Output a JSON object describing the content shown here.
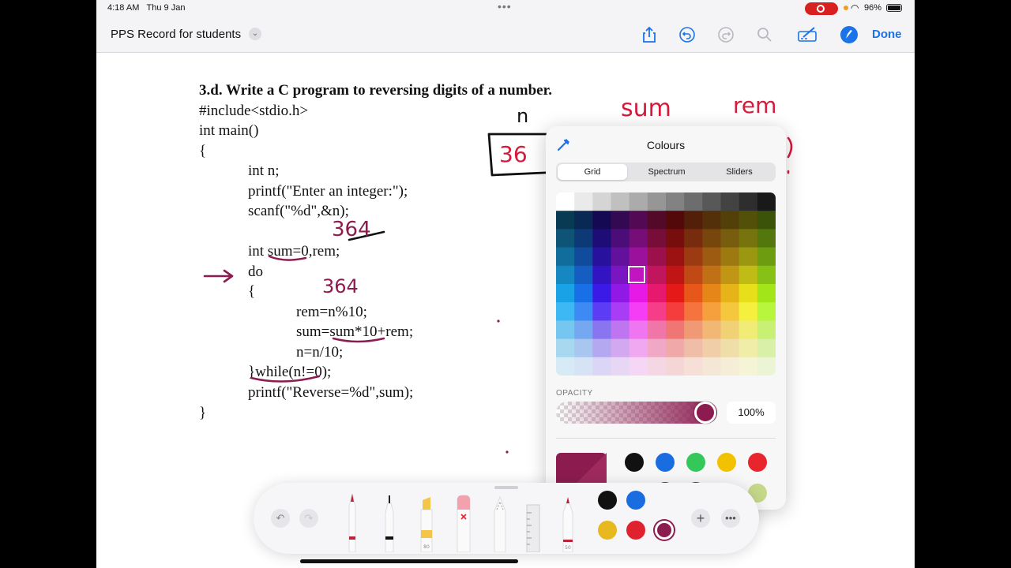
{
  "status_bar": {
    "time": "4:18 AM",
    "date": "Thu 9 Jan",
    "battery": "96%",
    "more_dots": "•••"
  },
  "nav": {
    "document_title": "PPS Record for students",
    "done_label": "Done",
    "icons": [
      "share-icon",
      "undo-icon",
      "redo-icon",
      "search-icon",
      "markup-icon",
      "pencil-circle-icon"
    ]
  },
  "document": {
    "lines": [
      "3.d. Write a C program to reversing digits of a number.",
      "#include<stdio.h>",
      "int main()",
      "{",
      "int n;",
      "printf(\"Enter an integer:\");",
      "scanf(\"%d\",&n);",
      "int sum=0,rem;",
      "do",
      "{",
      "rem=n%10;",
      "sum=sum*10+rem;",
      "n=n/10;",
      "}while(n!=0);",
      "printf(\"Reverse=%d\",sum);",
      "}"
    ]
  },
  "handwriting": {
    "n_label": "n",
    "sum_label": "sum",
    "rem_label": "rem",
    "n_box_value": "36",
    "scribble_top": "364",
    "scribble_mid": "364",
    "arrow": "→"
  },
  "colour_picker": {
    "title": "Colours",
    "tabs": [
      "Grid",
      "Spectrum",
      "Sliders"
    ],
    "active_tab": "Grid",
    "opacity_label": "OPACITY",
    "opacity_value": "100%",
    "selected_colour": "#8c1c50",
    "swatches_row1": [
      "#111111",
      "#1a6de0",
      "#34c759",
      "#f2c100",
      "#e8252c"
    ],
    "swatches_row2": [
      "#8c1c50",
      "#8c1c50",
      "#cde08a",
      "#c6d98a"
    ]
  },
  "toolbar": {
    "tools": [
      "pen",
      "fineliner",
      "highlighter",
      "eraser",
      "lasso",
      "ruler",
      "crayon"
    ],
    "highlighter_size": "80",
    "crayon_size": "50",
    "colour_dots": [
      "#e8b81f",
      "#e0222e",
      "#8c1c50"
    ]
  }
}
